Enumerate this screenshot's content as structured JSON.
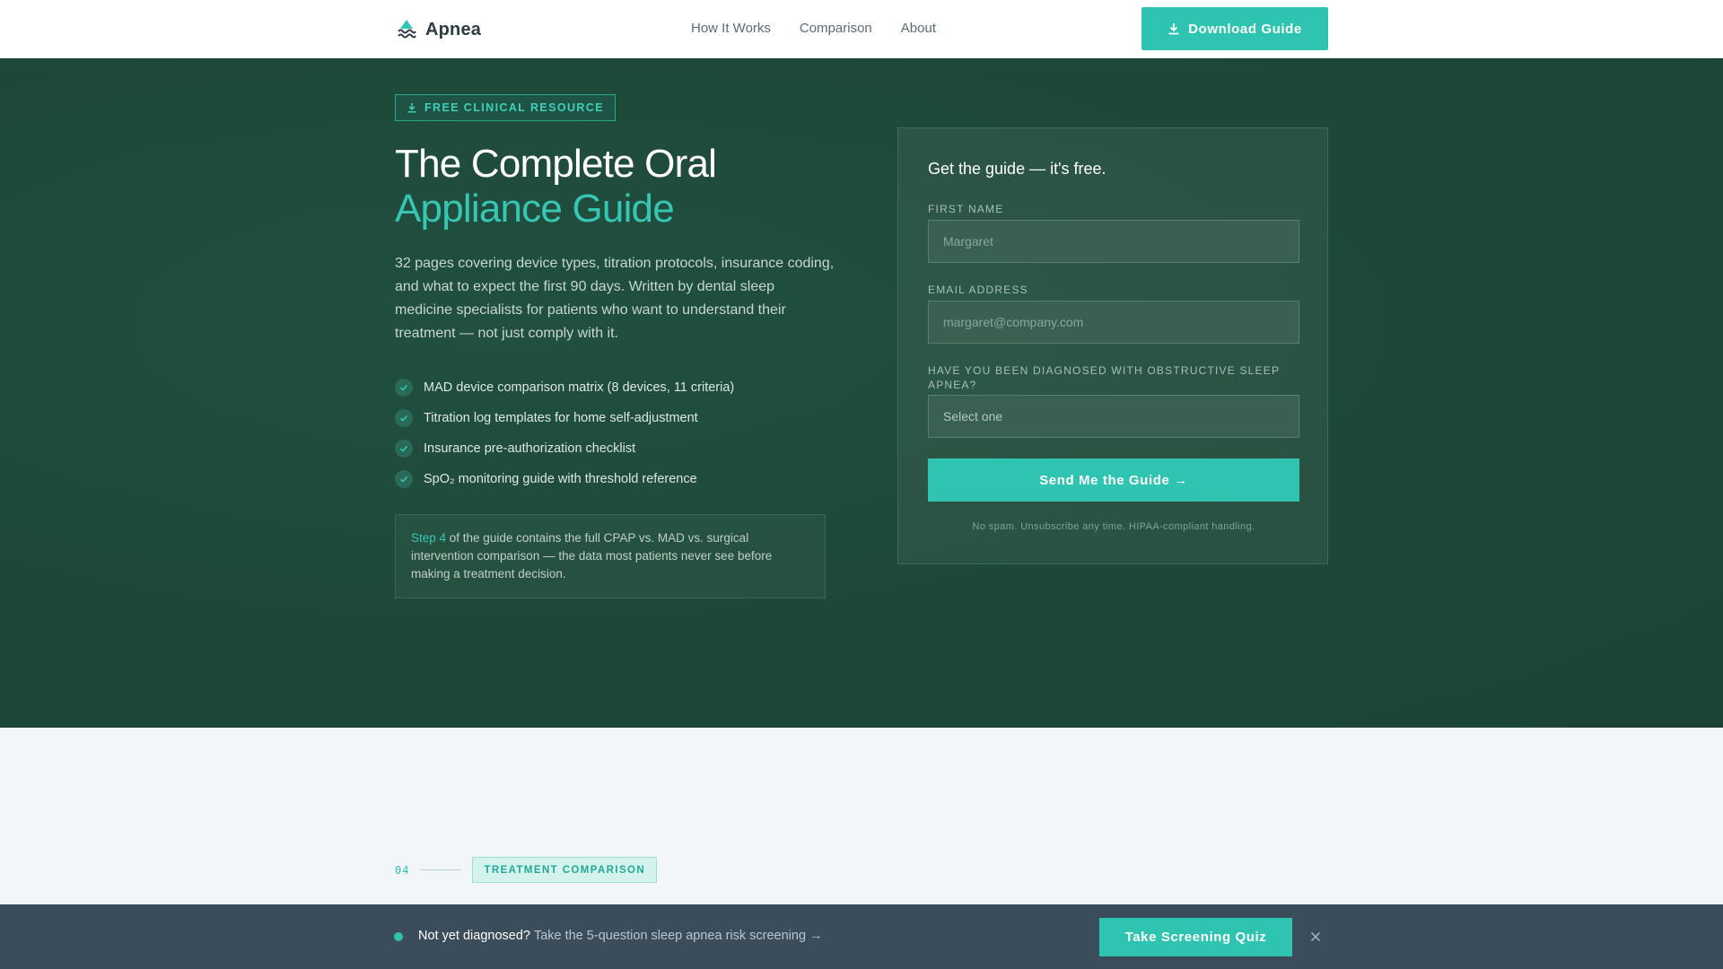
{
  "nav": {
    "brand": "Apnea",
    "brand_icon": "logo-waves-icon",
    "links": [
      {
        "label": "How It Works"
      },
      {
        "label": "Comparison"
      },
      {
        "label": "About"
      }
    ],
    "cta_label": "Download Guide",
    "cta_icon": "download-icon"
  },
  "hero": {
    "badge": "FREE CLINICAL RESOURCE",
    "badge_icon": "download-icon",
    "title_line1": "The Complete Oral",
    "title_line2": "Appliance Guide",
    "lede": "32 pages covering device types, titration protocols, insurance coding, and what to expect the first 90 days. Written by dental sleep medicine specialists for patients who want to understand their treatment — not just comply with it.",
    "features": [
      "MAD device comparison matrix (8 devices, 11 criteria)",
      "Titration log templates for home self-adjustment",
      "Insurance pre-authorization checklist",
      "SpO₂ monitoring guide with threshold reference"
    ],
    "note_step": "Step 4",
    "note_rest": " of the guide contains the full CPAP vs. MAD vs. surgical intervention comparison — the data most patients never see before making a treatment decision."
  },
  "form": {
    "title": "Get the guide — it's free.",
    "first_name_label": "FIRST NAME",
    "first_name_placeholder": "Margaret",
    "email_label": "EMAIL ADDRESS",
    "email_placeholder": "margaret@company.com",
    "osa_label": "HAVE YOU BEEN DIAGNOSED WITH OBSTRUCTIVE SLEEP APNEA?",
    "osa_selected": "Select one",
    "submit_label": "Send Me the Guide →",
    "disclaimer": "No spam. Unsubscribe any time. HIPAA-compliant handling."
  },
  "section": {
    "number": "04",
    "label": "TREATMENT COMPARISON"
  },
  "bottom_bar": {
    "strong": "Not yet diagnosed?",
    "text": "Take the 5-question sleep apnea risk screening →",
    "cta_label": "Take Screening Quiz",
    "close_icon": "close-icon"
  },
  "colors": {
    "accent": "#2ec4b1",
    "hero_bg": "#1e4a3a",
    "bar_bg": "#3b4c5a"
  }
}
